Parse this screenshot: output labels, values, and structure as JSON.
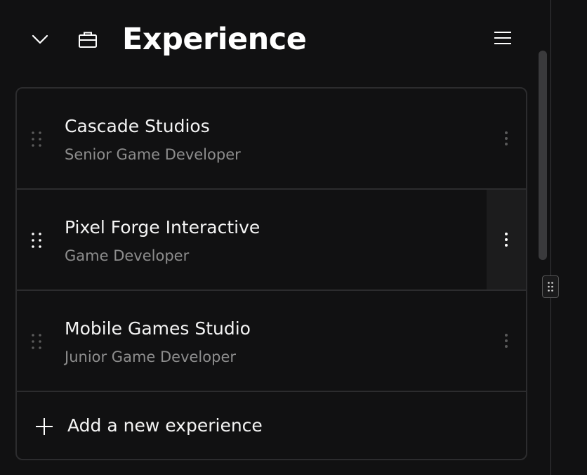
{
  "section": {
    "title": "Experience",
    "collapse_icon": "chevron-down-icon",
    "section_icon": "briefcase-icon",
    "menu_icon": "hamburger-menu-icon"
  },
  "experiences": [
    {
      "company": "Cascade Studios",
      "role": "Senior Game Developer"
    },
    {
      "company": "Pixel Forge Interactive",
      "role": "Game Developer"
    },
    {
      "company": "Mobile Games Studio",
      "role": "Junior Game Developer"
    }
  ],
  "add_button": {
    "label": "Add a new experience",
    "icon": "plus-icon"
  },
  "colors": {
    "background": "#111112",
    "border": "#2c2c2e",
    "text_primary": "#f4f4f4",
    "text_secondary": "#8d8d8d",
    "hover_bg": "#1c1c1d"
  }
}
